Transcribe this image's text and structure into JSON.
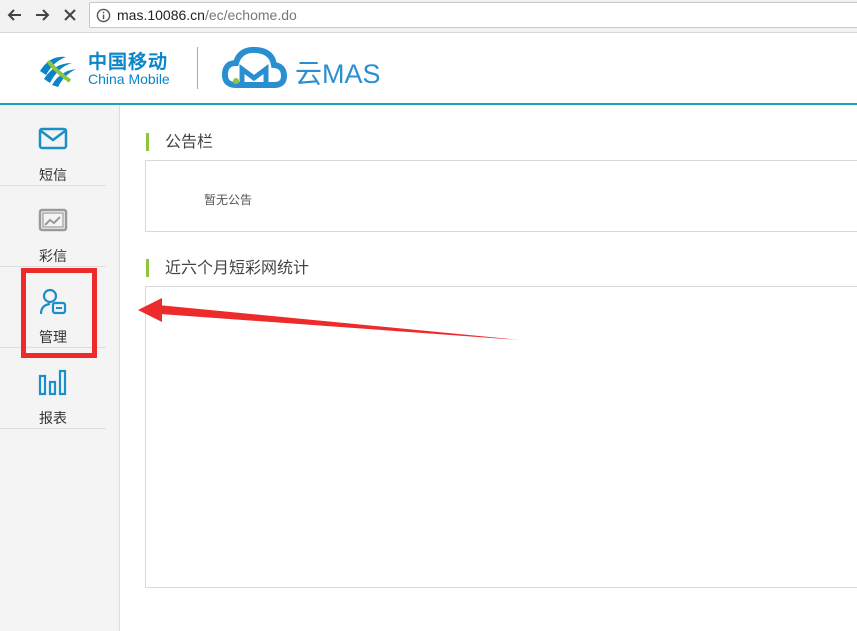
{
  "browser": {
    "url_host": "mas.10086.cn",
    "url_path": "/ec/echome.do",
    "icons": [
      "back-arrow-icon",
      "forward-arrow-icon",
      "close-icon",
      "info-icon"
    ]
  },
  "header": {
    "brand_cn": "中国移动",
    "brand_en": "China Mobile",
    "product": "云MAS",
    "accent_color": "#1aa3b8"
  },
  "sidebar": {
    "items": [
      {
        "label": "短信",
        "icon": "envelope-icon",
        "active": true
      },
      {
        "label": "彩信",
        "icon": "picture-icon",
        "active": false
      },
      {
        "label": "管理",
        "icon": "user-card-icon",
        "active": true
      },
      {
        "label": "报表",
        "icon": "bar-chart-icon",
        "active": true
      }
    ],
    "highlighted_item": "管理",
    "highlight_color": "#ee2b2b"
  },
  "main": {
    "notice_title": "公告栏",
    "notice_empty": "暂无公告",
    "stats_title": "近六个月短彩网统计"
  }
}
